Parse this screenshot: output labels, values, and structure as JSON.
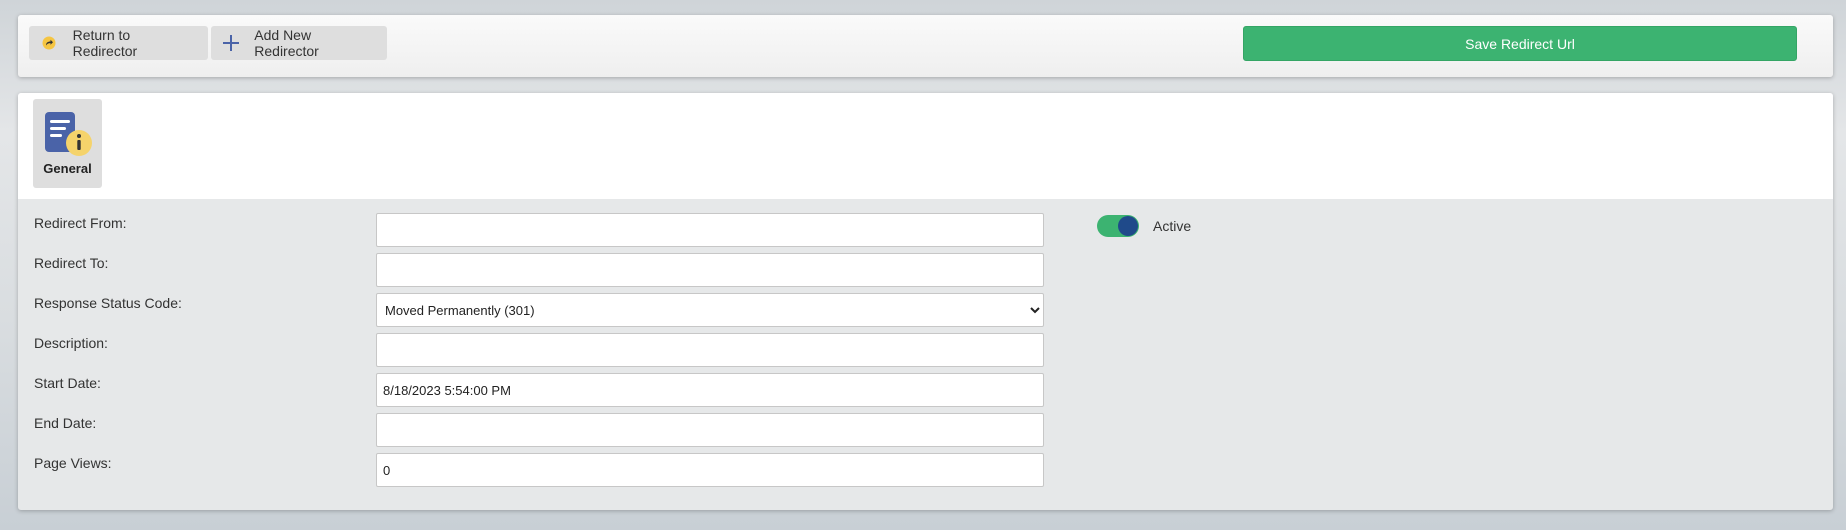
{
  "toolbar": {
    "return_label": "Return to Redirector",
    "add_label": "Add New Redirector",
    "save_label": "Save Redirect Url"
  },
  "tabs": [
    {
      "label": "General",
      "icon": "document-info-icon",
      "active": true
    }
  ],
  "form": {
    "redirect_from": {
      "label": "Redirect From:",
      "value": ""
    },
    "redirect_to": {
      "label": "Redirect To:",
      "value": ""
    },
    "status_code": {
      "label": "Response Status Code:",
      "selected": "Moved Permanently (301)"
    },
    "description": {
      "label": "Description:",
      "value": ""
    },
    "start_date": {
      "label": "Start Date:",
      "value": "8/18/2023 5:54:00 PM"
    },
    "end_date": {
      "label": "End Date:",
      "value": ""
    },
    "page_views": {
      "label": "Page Views:",
      "value": "0"
    }
  },
  "active_toggle": {
    "label": "Active",
    "on": true
  },
  "colors": {
    "save_green": "#3cb371",
    "toggle_knob": "#1f4a8a",
    "icon_blue": "#4a63a8",
    "icon_yellow": "#f5d36b"
  }
}
